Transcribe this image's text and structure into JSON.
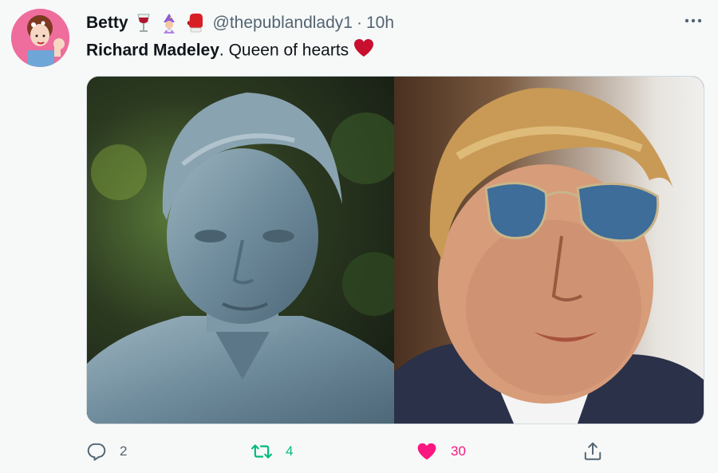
{
  "tweet": {
    "author_name": "Betty",
    "author_emojis": [
      "wine-glass",
      "mage",
      "boxing-glove"
    ],
    "handle": "@thepublandlady1",
    "separator": "·",
    "time": "10h",
    "more_label": "···",
    "text_bold": "Richard Madeley",
    "text_rest": ". Queen of hearts",
    "text_emoji": "red-heart",
    "media": [
      {
        "description_icon": "statue-photo"
      },
      {
        "description_icon": "man-sunglasses-photo"
      }
    ]
  },
  "actions": {
    "reply_count": "2",
    "retweet_count": "4",
    "like_count": "30"
  },
  "colors": {
    "retweet_active": "#00ba7c",
    "like_active": "#f91880",
    "muted": "#536471"
  }
}
